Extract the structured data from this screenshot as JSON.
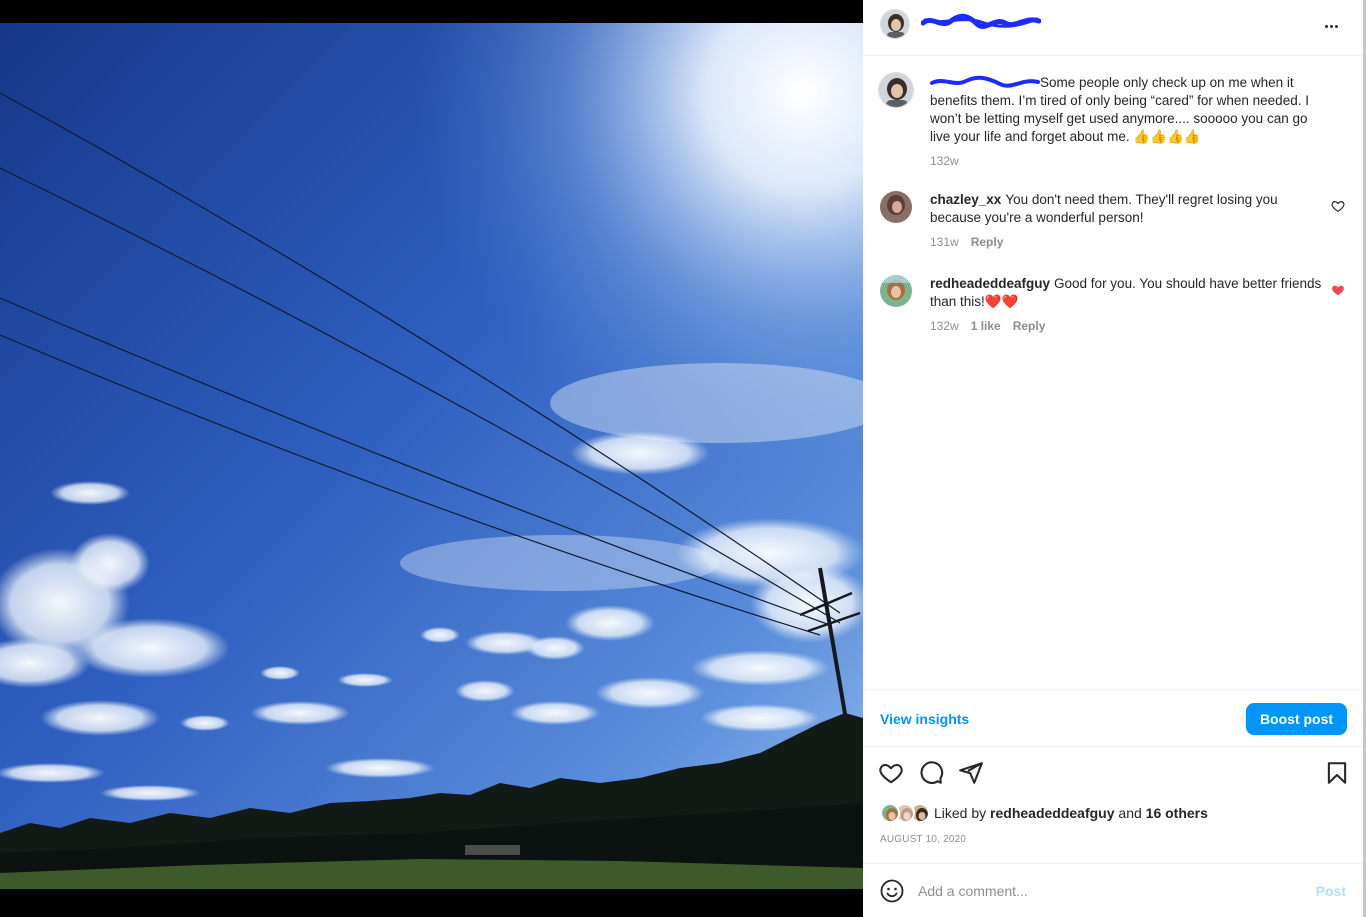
{
  "post": {
    "owner_redacted": true,
    "more_icon": "more-horizontal-icon"
  },
  "caption": {
    "text": "Some people only check up on me when it benefits them. I’m tired of only being “cared” for when needed. I won’t be letting myself get used anymore.... sooooo you can go live your life and forget about me. 👍👍👍👍",
    "age": "132w"
  },
  "comments": [
    {
      "username": "chazley_xx",
      "text": "You don't need them. They'll regret losing you because you're a wonderful person!",
      "age": "131w",
      "likes": "",
      "reply_label": "Reply",
      "liked": false
    },
    {
      "username": "redheadeddeafguy",
      "text": "Good for you. You should have better friends than this!❤️❤️",
      "age": "132w",
      "likes": "1 like",
      "reply_label": "Reply",
      "liked": true
    }
  ],
  "insights": {
    "view_label": "View insights",
    "boost_label": "Boost post"
  },
  "actions": {
    "like_icon": "heart-icon",
    "comment_icon": "comment-icon",
    "share_icon": "share-icon",
    "save_icon": "bookmark-icon"
  },
  "likes": {
    "prefix": "Liked by ",
    "first_liker": "redheadeddeafguy",
    "connector": " and ",
    "others": "16 others"
  },
  "date": "AUGUST 10, 2020",
  "add_comment": {
    "placeholder": "Add a comment...",
    "post_label": "Post"
  },
  "colors": {
    "accent": "#0095f6",
    "like_red": "#ed4956",
    "muted": "#8e8e8e",
    "post_disabled": "#b2dffc"
  }
}
